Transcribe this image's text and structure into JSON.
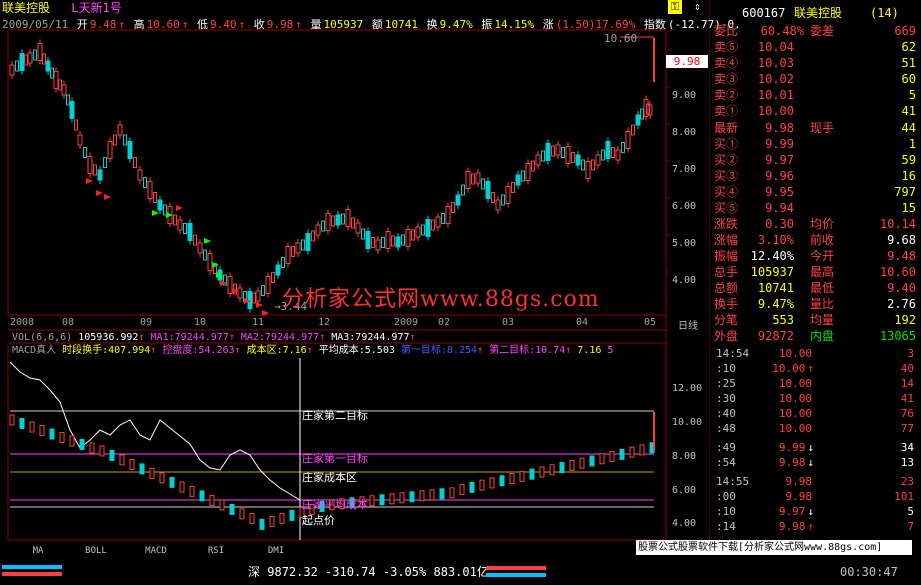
{
  "title": {
    "stock": "联美控股",
    "formula": "L天新1号"
  },
  "quote_line": {
    "date": "2009/05/11",
    "open_label": "开",
    "open": "9.48",
    "high_label": "高",
    "high": "10.60",
    "low_label": "低",
    "low": "9.40",
    "close_label": "收",
    "close": "9.98",
    "vol_label": "量",
    "vol": "105937",
    "amt_label": "额",
    "amt": "10741",
    "turn_label": "换",
    "turn": "9.47%",
    "amp_label": "振",
    "amp": "14.15%",
    "chg_label": "涨",
    "chg": "(1.50)17.69%",
    "index_label": "指数",
    "index": "(-12.77)-0."
  },
  "price_axis": [
    "10.60",
    "9.98",
    "9.00",
    "8.00",
    "7.00",
    "6.00",
    "5.00",
    "4.00"
  ],
  "price_markers": {
    "high": "10.60",
    "low": "3.44",
    "current": "9.98"
  },
  "date_axis": [
    "2008",
    "08",
    "09",
    "10",
    "11",
    "12",
    "2009",
    "02",
    "03",
    "04",
    "05",
    "日线"
  ],
  "vol_line": {
    "label": "VOL(6,6,6)",
    "val": "105936.992",
    "ma1": "MA1:79244.977",
    "ma2": "MA2:79244.977",
    "ma3": "MA3:79244.977"
  },
  "macd_line": {
    "label": "MACD真人",
    "t1": "时段换手:407.994",
    "t2": "控盘度:54.263",
    "t3": "成本区:7.16",
    "t4": "平均成本:5.503",
    "t5": "第一目标:8.254",
    "t6": "第二目标:10.74",
    "t7": "7.16",
    "t8": "5"
  },
  "lower_axis": [
    "12.00",
    "10.00",
    "8.00",
    "6.00",
    "4.00"
  ],
  "lower_labels": {
    "second": "庄家第二目标",
    "first": "庄家第一目标",
    "cost": "庄家成本区",
    "avg": "庄家平均成本",
    "start": "起点价"
  },
  "watermark": "分析家公式网www.88gs.com",
  "bottom_tabs": [
    "MA",
    "BOLL",
    "MACD",
    "RSI",
    "DMI"
  ],
  "bottom_link": "股票公式股票软件下载[分析家公式网www.88gs.com]",
  "right_panel": {
    "code": "600167",
    "name": "联美控股",
    "num": "(14)",
    "ratio_label": "委比",
    "ratio": "60.48%",
    "diff_label": "委差",
    "diff": "669",
    "asks": [
      {
        "label": "卖⑤",
        "price": "10.04",
        "vol": "62"
      },
      {
        "label": "卖④",
        "price": "10.03",
        "vol": "51"
      },
      {
        "label": "卖③",
        "price": "10.02",
        "vol": "60"
      },
      {
        "label": "卖②",
        "price": "10.01",
        "vol": "5"
      },
      {
        "label": "卖①",
        "price": "10.00",
        "vol": "41"
      }
    ],
    "last_label": "最新",
    "last": "9.98",
    "hand_label": "现手",
    "hand": "44",
    "bids": [
      {
        "label": "买①",
        "price": "9.99",
        "vol": "1"
      },
      {
        "label": "买②",
        "price": "9.97",
        "vol": "59"
      },
      {
        "label": "买③",
        "price": "9.96",
        "vol": "16"
      },
      {
        "label": "买④",
        "price": "9.95",
        "vol": "797"
      },
      {
        "label": "买⑤",
        "price": "9.94",
        "vol": "15"
      }
    ],
    "stats": [
      {
        "l1": "涨跌",
        "v1": "0.30",
        "l2": "均价",
        "v2": "10.14"
      },
      {
        "l1": "涨幅",
        "v1": "3.10%",
        "l2": "前收",
        "v2": "9.68"
      },
      {
        "l1": "振幅",
        "v1": "12.40%",
        "l2": "今开",
        "v2": "9.48"
      },
      {
        "l1": "总手",
        "v1": "105937",
        "l2": "最高",
        "v2": "10.60"
      },
      {
        "l1": "总额",
        "v1": "10741",
        "l2": "最低",
        "v2": "9.40"
      },
      {
        "l1": "换手",
        "v1": "9.47%",
        "l2": "量比",
        "v2": "2.76"
      },
      {
        "l1": "分笔",
        "v1": "553",
        "l2": "均量",
        "v2": "192"
      }
    ],
    "outer_label": "外盘",
    "outer": "92872",
    "inner_label": "内盘",
    "inner": "13065",
    "ticks": [
      {
        "t": "14:54",
        "p": "10.00",
        "arrow": "",
        "q": "3"
      },
      {
        "t": ":10",
        "p": "10.00",
        "arrow": "↑",
        "q": "40"
      },
      {
        "t": ":25",
        "p": "10.00",
        "arrow": "",
        "q": "14"
      },
      {
        "t": ":30",
        "p": "10.00",
        "arrow": "",
        "q": "41"
      },
      {
        "t": ":40",
        "p": "10.00",
        "arrow": "",
        "q": "76"
      },
      {
        "t": ":48",
        "p": "10.00",
        "arrow": "",
        "q": "77"
      },
      {
        "t": ":49",
        "p": "9.99",
        "arrow": "↓",
        "q": "34"
      },
      {
        "t": ":54",
        "p": "9.98",
        "arrow": "↓",
        "q": "13"
      },
      {
        "t": "14:55",
        "p": "9.98",
        "arrow": "",
        "q": "23"
      },
      {
        "t": ":00",
        "p": "9.98",
        "arrow": "",
        "q": "101"
      },
      {
        "t": ":10",
        "p": "9.97",
        "arrow": "↓",
        "q": "5"
      },
      {
        "t": ":14",
        "p": "9.98",
        "arrow": "↑",
        "q": "7"
      }
    ]
  },
  "status_bar": {
    "market": "深",
    "index": "9872.32",
    "change": "-310.74",
    "pct": "-3.05%",
    "amount": "883.01亿",
    "time": "00:30:47"
  }
}
